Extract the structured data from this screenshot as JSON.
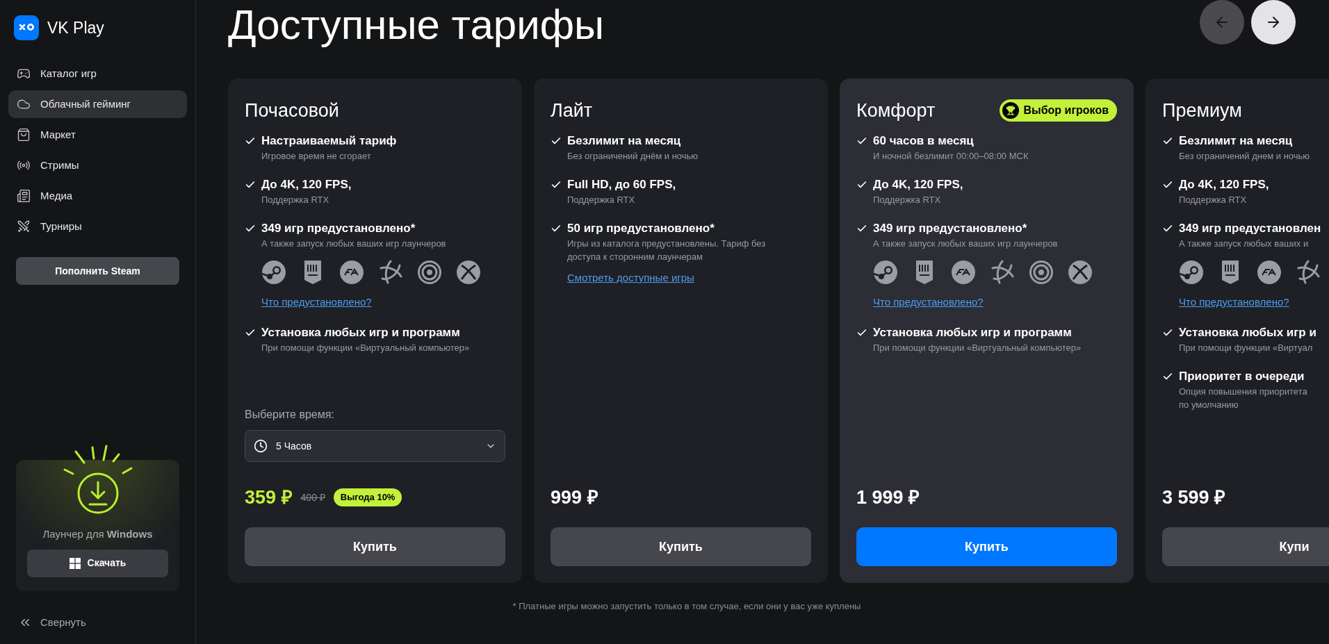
{
  "sidebar": {
    "brand": "VK Play",
    "nav": [
      {
        "label": "Каталог игр",
        "selected": false
      },
      {
        "label": "Облачный гейминг",
        "selected": true
      },
      {
        "label": "Маркет",
        "selected": false
      },
      {
        "label": "Стримы",
        "selected": false
      },
      {
        "label": "Медиа",
        "selected": false
      },
      {
        "label": "Турниры",
        "selected": false
      }
    ],
    "steam_button": "Пополнить Steam",
    "launcher": {
      "text": "Лаунчер для **Windows**",
      "button": "Скачать"
    },
    "collapse": "Свернуть"
  },
  "title": "Доступные тарифы",
  "pager": [
    {
      "disabled": true
    },
    {
      "disabled": false
    }
  ],
  "cards": [
    {
      "title": "Почасовой",
      "highlighted": false,
      "features": [
        {
          "title": "Настраиваемый тариф",
          "subtitle": "Игровое время не сгорает"
        },
        {
          "title": "До 4K, 120 FPS,",
          "subtitle": "Поддержка RTX"
        },
        {
          "title": "349 игр предустановлено*",
          "subtitle": "А также запуск любых ваших игр лаунчеров",
          "launchers": [
            {
              "kind": "steam"
            },
            {
              "kind": "epic"
            },
            {
              "kind": "ea"
            },
            {
              "kind": "battlenet"
            },
            {
              "kind": "ubisoft"
            },
            {
              "kind": "xbox"
            }
          ],
          "link": "Что предустановлено?"
        },
        {
          "title": "Установка любых игр и программ",
          "subtitle": "При помощи функции «Виртуальный компьютер»"
        }
      ],
      "time_select": {
        "label": "Выберите время:",
        "value": "5 Часов"
      },
      "price": "359 ₽",
      "old_price": "400 ₽",
      "discount": "Выгода 10%",
      "buy": "Купить",
      "primary": false
    },
    {
      "title": "Лайт",
      "highlighted": false,
      "features": [
        {
          "title": "Безлимит на месяц",
          "subtitle": "Без ограничений днём и ночью"
        },
        {
          "title": "Full HD, до 60 FPS,",
          "subtitle": "Поддержка RTX"
        },
        {
          "title": "50 игр предустановлено*",
          "subtitle": "Игры из каталога предустановлены. Тариф без доступа к сторонним лаунчерам",
          "link": "Смотреть доступные игры"
        }
      ],
      "price": "999 ₽",
      "buy": "Купить",
      "primary": false
    },
    {
      "title": "Комфорт",
      "badge": "Выбор игроков",
      "highlighted": true,
      "features": [
        {
          "title": "60 часов в месяц",
          "subtitle": "И ночной безлимит 00:00–08:00 МСК"
        },
        {
          "title": "До 4K, 120 FPS,",
          "subtitle": "Поддержка RTX"
        },
        {
          "title": "349 игр предустановлено*",
          "subtitle": "А также запуск любых ваших игр лаунчеров",
          "launchers": [
            {
              "kind": "steam"
            },
            {
              "kind": "epic"
            },
            {
              "kind": "ea"
            },
            {
              "kind": "battlenet"
            },
            {
              "kind": "ubisoft"
            },
            {
              "kind": "xbox"
            }
          ],
          "link": "Что предустановлено?"
        },
        {
          "title": "Установка любых игр и программ",
          "subtitle": "При помощи функции «Виртуальный компьютер»"
        }
      ],
      "price": "1 999 ₽",
      "buy": "Купить",
      "primary": true
    },
    {
      "title": "Премиум",
      "highlighted": false,
      "features": [
        {
          "title": "Безлимит на месяц",
          "subtitle": "Без ограничений днем и ночью"
        },
        {
          "title": "До 4K, 120 FPS,",
          "subtitle": "Поддержка RTX"
        },
        {
          "title": "349 игр предустановлен",
          "subtitle": "А также запуск любых ваших и",
          "launchers": [
            {
              "kind": "steam"
            },
            {
              "kind": "epic"
            },
            {
              "kind": "ea"
            },
            {
              "kind": "battlenet"
            }
          ],
          "link": "Что предустановлено?"
        },
        {
          "title": "Установка любых игр и",
          "subtitle": "При помощи функции «Виртуал"
        },
        {
          "title": "Приоритет в очереди",
          "subtitle": "Опция повышения приоритета по умолчанию"
        }
      ],
      "price": "3 599 ₽",
      "buy": "Купи",
      "primary": false
    }
  ],
  "footnote": "* Платные игры можно запустить только в том случае, если они у вас уже куплены"
}
